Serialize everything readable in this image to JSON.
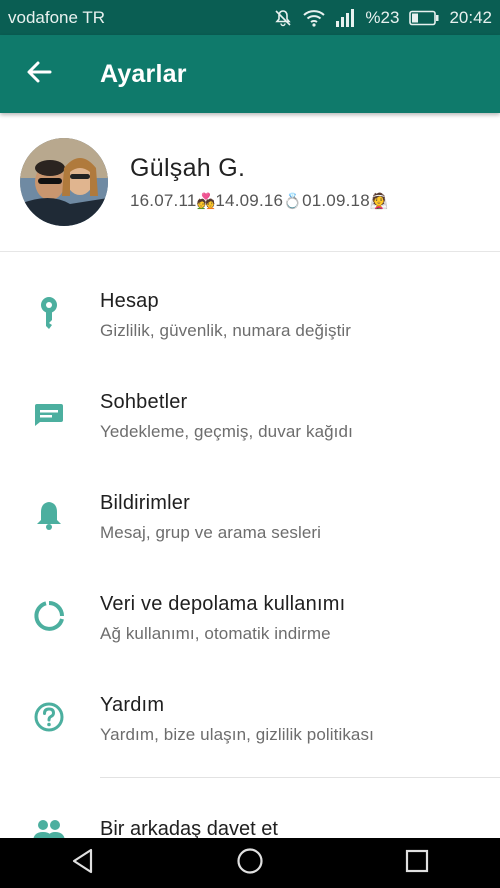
{
  "status_bar": {
    "carrier": "vodafone TR",
    "battery": "%23",
    "time": "20:42",
    "icons": [
      "mute-icon",
      "wifi-icon",
      "signal-icon",
      "battery-icon"
    ]
  },
  "app_bar": {
    "title": "Ayarlar"
  },
  "profile": {
    "name": "Gülşah G.",
    "about_parts": [
      "16.07.11",
      "💑",
      "14.09.16",
      "💍",
      "01.09.18",
      "👰"
    ]
  },
  "settings": [
    {
      "title": "Hesap",
      "subtitle": "Gizlilik, güvenlik, numara değiştir",
      "icon": "key-icon"
    },
    {
      "title": "Sohbetler",
      "subtitle": "Yedekleme, geçmiş, duvar kağıdı",
      "icon": "chat-icon"
    },
    {
      "title": "Bildirimler",
      "subtitle": "Mesaj, grup ve arama sesleri",
      "icon": "bell-icon"
    },
    {
      "title": "Veri ve depolama kullanımı",
      "subtitle": "Ağ kullanımı, otomatik indirme",
      "icon": "data-usage-icon"
    },
    {
      "title": "Yardım",
      "subtitle": "Yardım, bize ulaşın, gizlilik politikası",
      "icon": "help-icon"
    }
  ],
  "invite": {
    "title": "Bir arkadaş davet et",
    "icon": "people-icon"
  },
  "colors": {
    "status_bar": "#0a5e53",
    "app_bar": "#0f7a6b",
    "icon": "#4caf9f"
  }
}
